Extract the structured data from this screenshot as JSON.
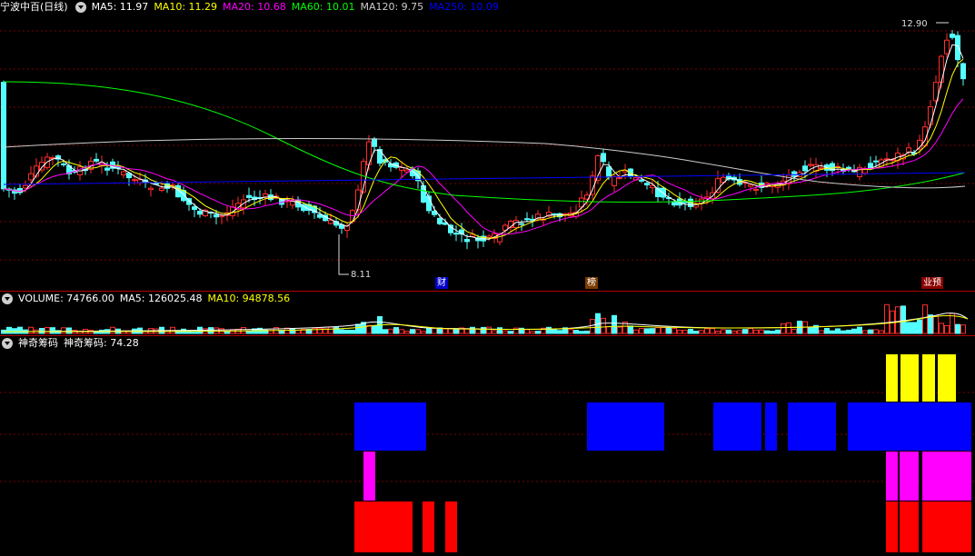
{
  "main_panel": {
    "title": "宁波中百(日线)",
    "ma_legend": [
      {
        "label": "MA5: 11.97",
        "color": "#ffffff"
      },
      {
        "label": "MA10: 11.29",
        "color": "#ffff00"
      },
      {
        "label": "MA20: 10.68",
        "color": "#ff00ff"
      },
      {
        "label": "MA60: 10.01",
        "color": "#00ff00"
      },
      {
        "label": "MA120: 9.75",
        "color": "#cccccc"
      },
      {
        "label": "MA250: 10.09",
        "color": "#0000ff"
      }
    ],
    "high_label": "12.90",
    "low_label": "8.11",
    "event_tags": [
      {
        "text": "财",
        "bg": "#0000c8"
      },
      {
        "text": "榜",
        "bg": "#7a3a00"
      },
      {
        "text": "业预",
        "bg": "#8b0000"
      }
    ],
    "colors": {
      "up": "#ff2d2d",
      "down": "#54ffff",
      "grid": "#7a0000"
    }
  },
  "volume_panel": {
    "title": "VOLUME: 74766.00",
    "ma5": "MA5: 126025.48",
    "ma10": "MA10: 94878.56"
  },
  "chip_panel": {
    "title": "神奇筹码",
    "value_label": "神奇筹码: 74.28",
    "colors": {
      "yellow": "#ffff00",
      "blue": "#0000ff",
      "magenta": "#ff00ff",
      "red": "#ff0000"
    }
  }
}
